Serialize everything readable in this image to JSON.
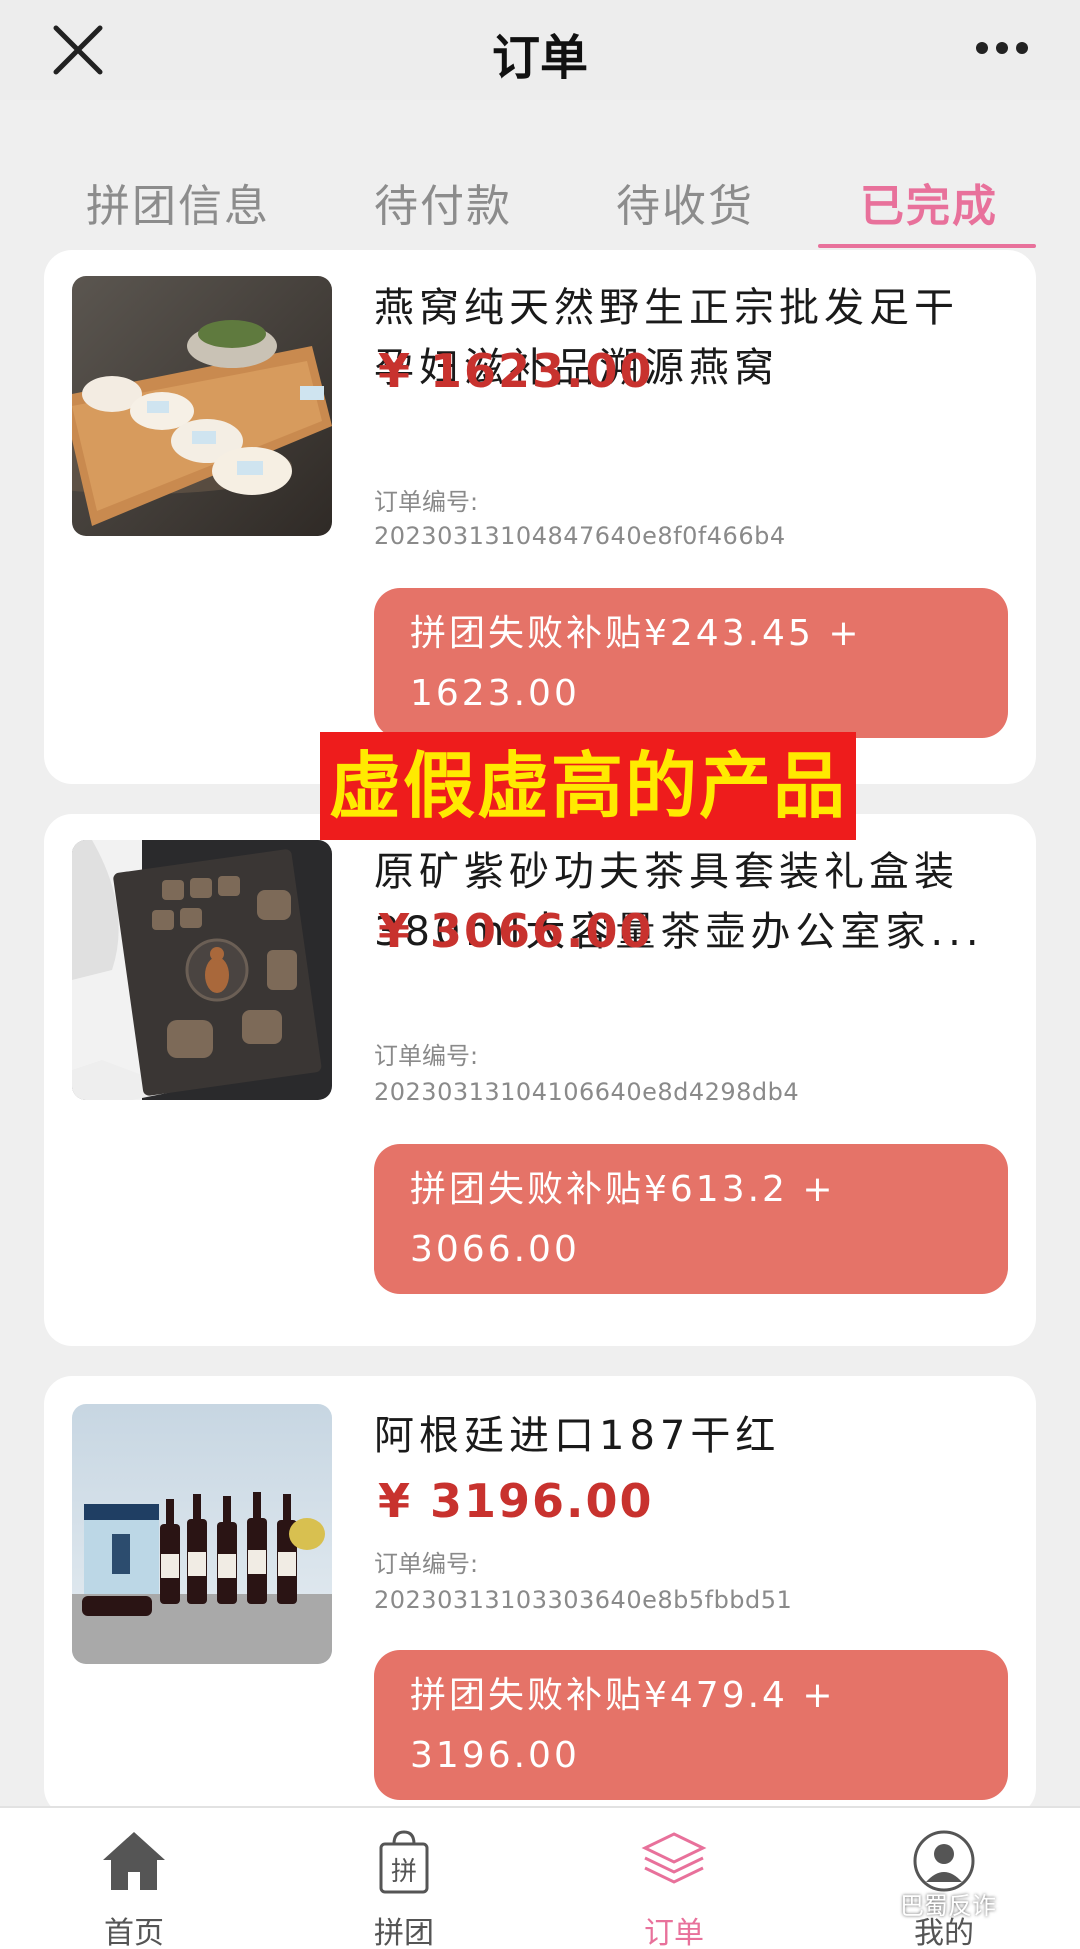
{
  "header": {
    "title": "订单"
  },
  "tabs": [
    {
      "label": "拼团信息",
      "active": false
    },
    {
      "label": "待付款",
      "active": false
    },
    {
      "label": "待收货",
      "active": false
    },
    {
      "label": "已完成",
      "active": true
    }
  ],
  "orders": [
    {
      "name": "燕窝纯天然野生正宗批发足干孕妇滋补品溯源燕窝",
      "price": "¥ 1623.00",
      "order_label": "订单编号:",
      "order_no": "20230313104847640e8f0f466b4",
      "subsidy_line1": "拼团失败补贴¥243.45 +",
      "subsidy_line2": "1623.00"
    },
    {
      "name": "原矿紫砂功夫茶具套装礼盒装380ml大容量茶壶办公室家...",
      "price": "¥ 3066.00",
      "order_label": "订单编号:",
      "order_no": "20230313104106640e8d4298db4",
      "subsidy_line1": "拼团失败补贴¥613.2 +",
      "subsidy_line2": "3066.00"
    },
    {
      "name": "阿根廷进口187干红",
      "price": "¥ 3196.00",
      "order_label": "订单编号:",
      "order_no": "20230313103303640e8b5fbbd51",
      "subsidy_line1": "拼团失败补贴¥479.4 +",
      "subsidy_line2": "3196.00"
    }
  ],
  "overlay_banner": "虚假虚高的产品",
  "bottom_nav": [
    {
      "label": "首页",
      "icon": "home-icon",
      "active": false
    },
    {
      "label": "拼团",
      "icon": "group-buy-bag-icon",
      "icon_char": "拼",
      "active": false
    },
    {
      "label": "订单",
      "icon": "orders-stack-icon",
      "active": true
    },
    {
      "label": "我的",
      "icon": "profile-icon",
      "active": false
    }
  ],
  "watermark": "巴蜀反诈",
  "colors": {
    "accent_pink": "#e8719b",
    "price_red": "#c8322e",
    "subsidy_button": "#e57368",
    "banner_bg": "#ee1c1c",
    "banner_text": "#ffea00"
  }
}
